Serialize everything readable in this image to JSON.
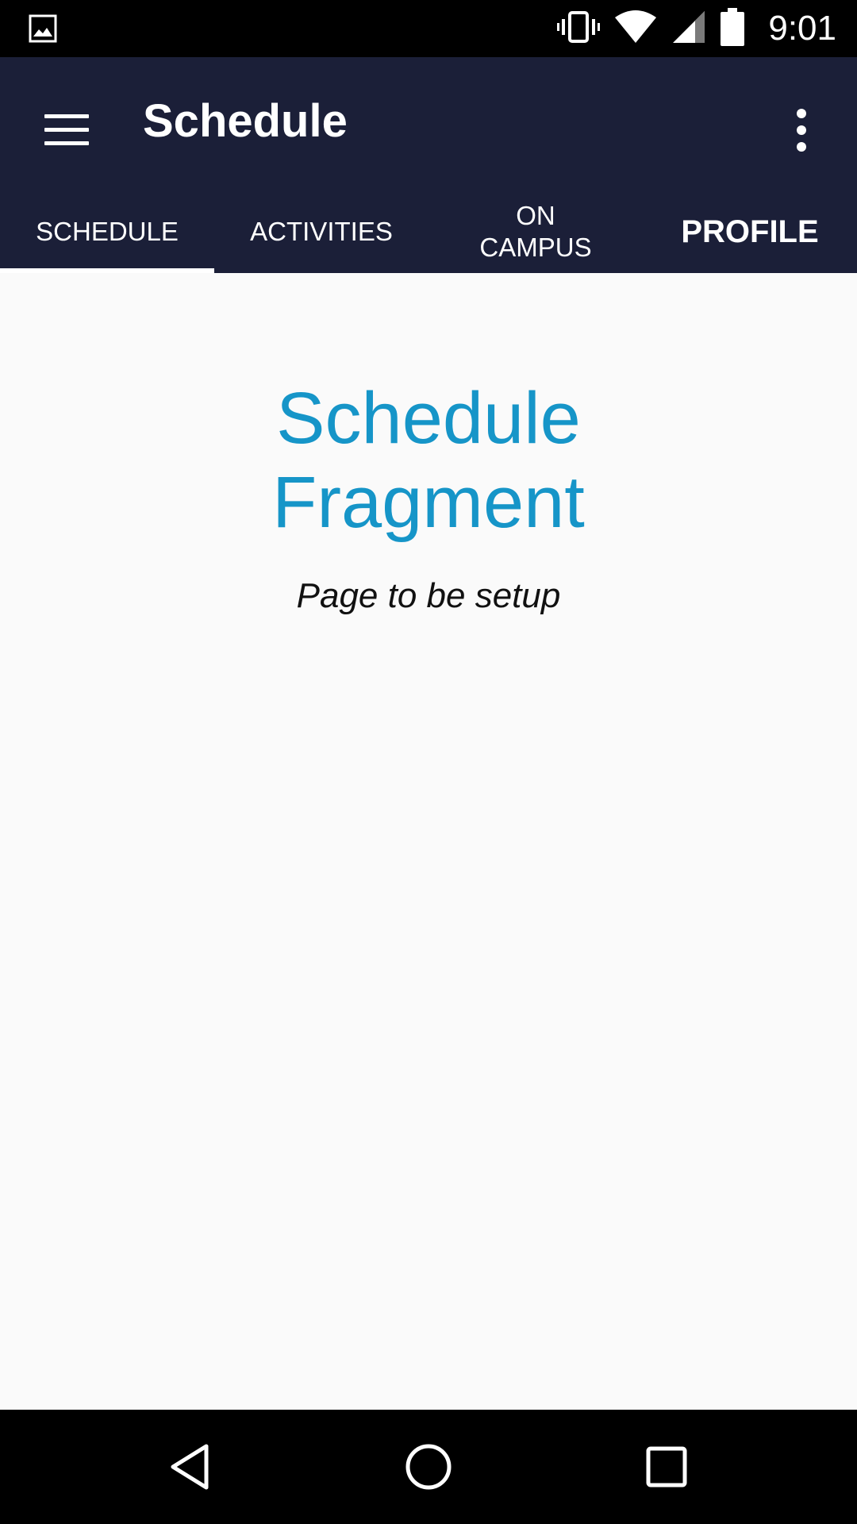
{
  "status_bar": {
    "time": "9:01",
    "icons": [
      "image-notification-icon",
      "vibrate-icon",
      "wifi-icon",
      "cell-signal-icon",
      "battery-icon"
    ]
  },
  "toolbar": {
    "title": "Schedule",
    "menu_icon": "hamburger-menu-icon",
    "overflow_icon": "more-vert-icon"
  },
  "tabs": [
    {
      "label": "SCHEDULE",
      "active": true
    },
    {
      "label": "ACTIVITIES",
      "active": false
    },
    {
      "label_line1": "ON",
      "label_line2": "CAMPUS",
      "active": false
    },
    {
      "label": "PROFILE",
      "active": false
    }
  ],
  "content": {
    "title_line1": "Schedule",
    "title_line2": "Fragment",
    "subtitle": "Page to be setup"
  },
  "nav_bar": {
    "icons": [
      "back-icon",
      "home-icon",
      "recents-icon"
    ]
  },
  "colors": {
    "app_bar": "#1b1f38",
    "accent_text": "#1695c8",
    "background": "#fafafa"
  }
}
